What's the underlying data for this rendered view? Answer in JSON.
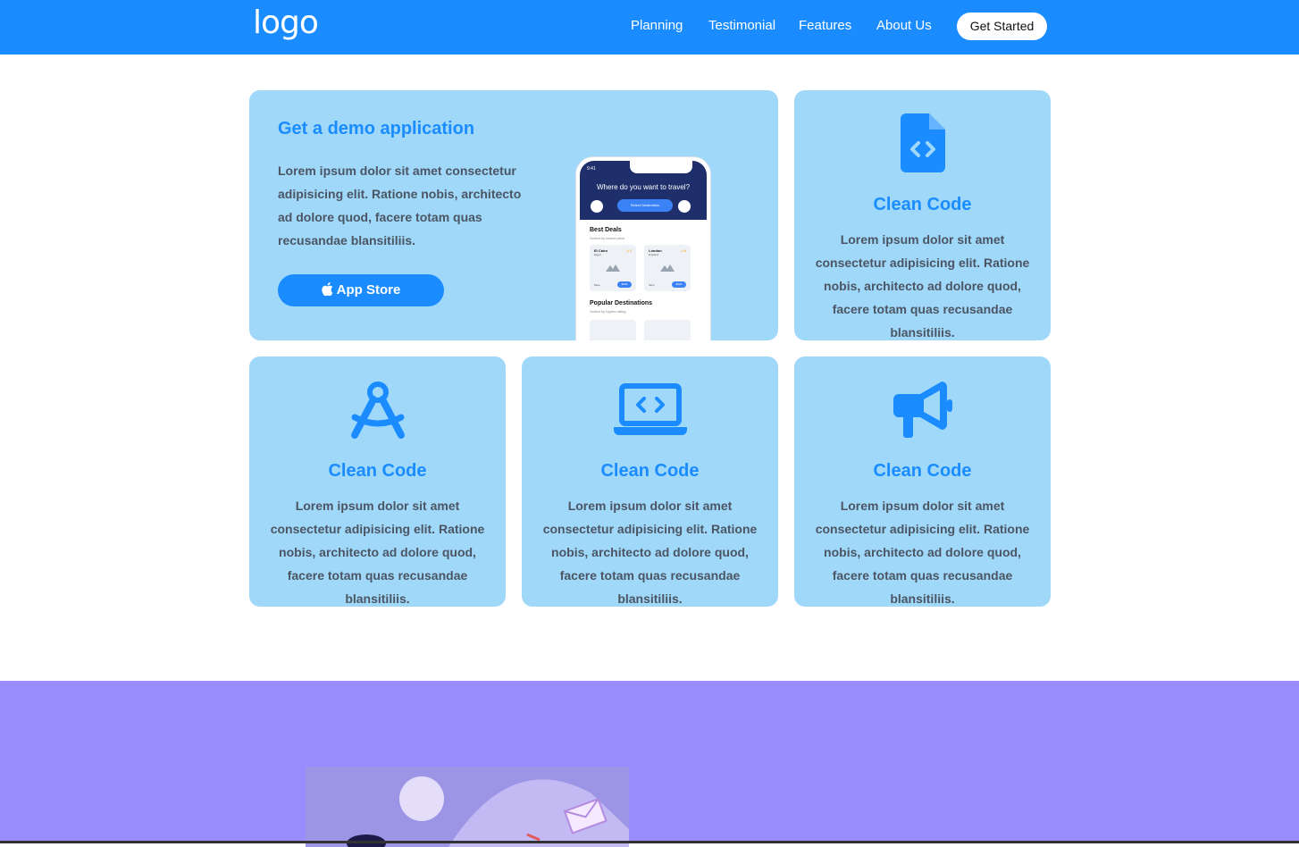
{
  "header": {
    "logo_text": "logo",
    "nav": [
      {
        "label": "Planning"
      },
      {
        "label": "Testimonial"
      },
      {
        "label": "Features"
      },
      {
        "label": "About Us"
      }
    ],
    "cta_label": "Get Started"
  },
  "demo": {
    "title": "Get a demo application",
    "text": "Lorem ipsum dolor sit amet consectetur adipisicing elit. Ratione nobis, architecto ad dolore quod, facere totam quas recusandae blansitiliis.",
    "button_label": "App Store",
    "button_icon": "apple-icon",
    "phone": {
      "time": "9:41",
      "question": "Where do you want to travel?",
      "select_label": "Select Destination",
      "best_deals": "Best Deals",
      "best_deals_sub": "Sorted by lowest price",
      "deals": [
        {
          "city": "El Cairo",
          "country": "Egypt",
          "rating": "4.2",
          "more": "More",
          "price": "$340"
        },
        {
          "city": "London",
          "country": "England",
          "rating": "4.6",
          "more": "More",
          "price": "$520"
        }
      ],
      "popular": "Popular Destinations",
      "popular_sub": "Sorted by higher rating"
    }
  },
  "features": [
    {
      "icon": "file-code-icon",
      "title": "Clean Code",
      "text": "Lorem ipsum dolor sit amet consectetur adipisicing elit. Ratione nobis, architecto ad dolore quod, facere totam quas recusandae blansitiliis."
    },
    {
      "icon": "compass-drafting-icon",
      "title": "Clean Code",
      "text": "Lorem ipsum dolor sit amet consectetur adipisicing elit. Ratione nobis, architecto ad dolore quod, facere totam quas recusandae blansitiliis."
    },
    {
      "icon": "laptop-code-icon",
      "title": "Clean Code",
      "text": "Lorem ipsum dolor sit amet consectetur adipisicing elit. Ratione nobis, architecto ad dolore quod, facere totam quas recusandae blansitiliis."
    },
    {
      "icon": "megaphone-icon",
      "title": "Clean Code",
      "text": "Lorem ipsum dolor sit amet consectetur adipisicing elit. Ratione nobis, architecto ad dolore quod, facere totam quas recusandae blansitiliis."
    }
  ],
  "colors": {
    "primary": "#1a8cff",
    "card_bg": "#a0d8fa",
    "body_text": "#4b5563",
    "section_purple": "#998cff"
  }
}
